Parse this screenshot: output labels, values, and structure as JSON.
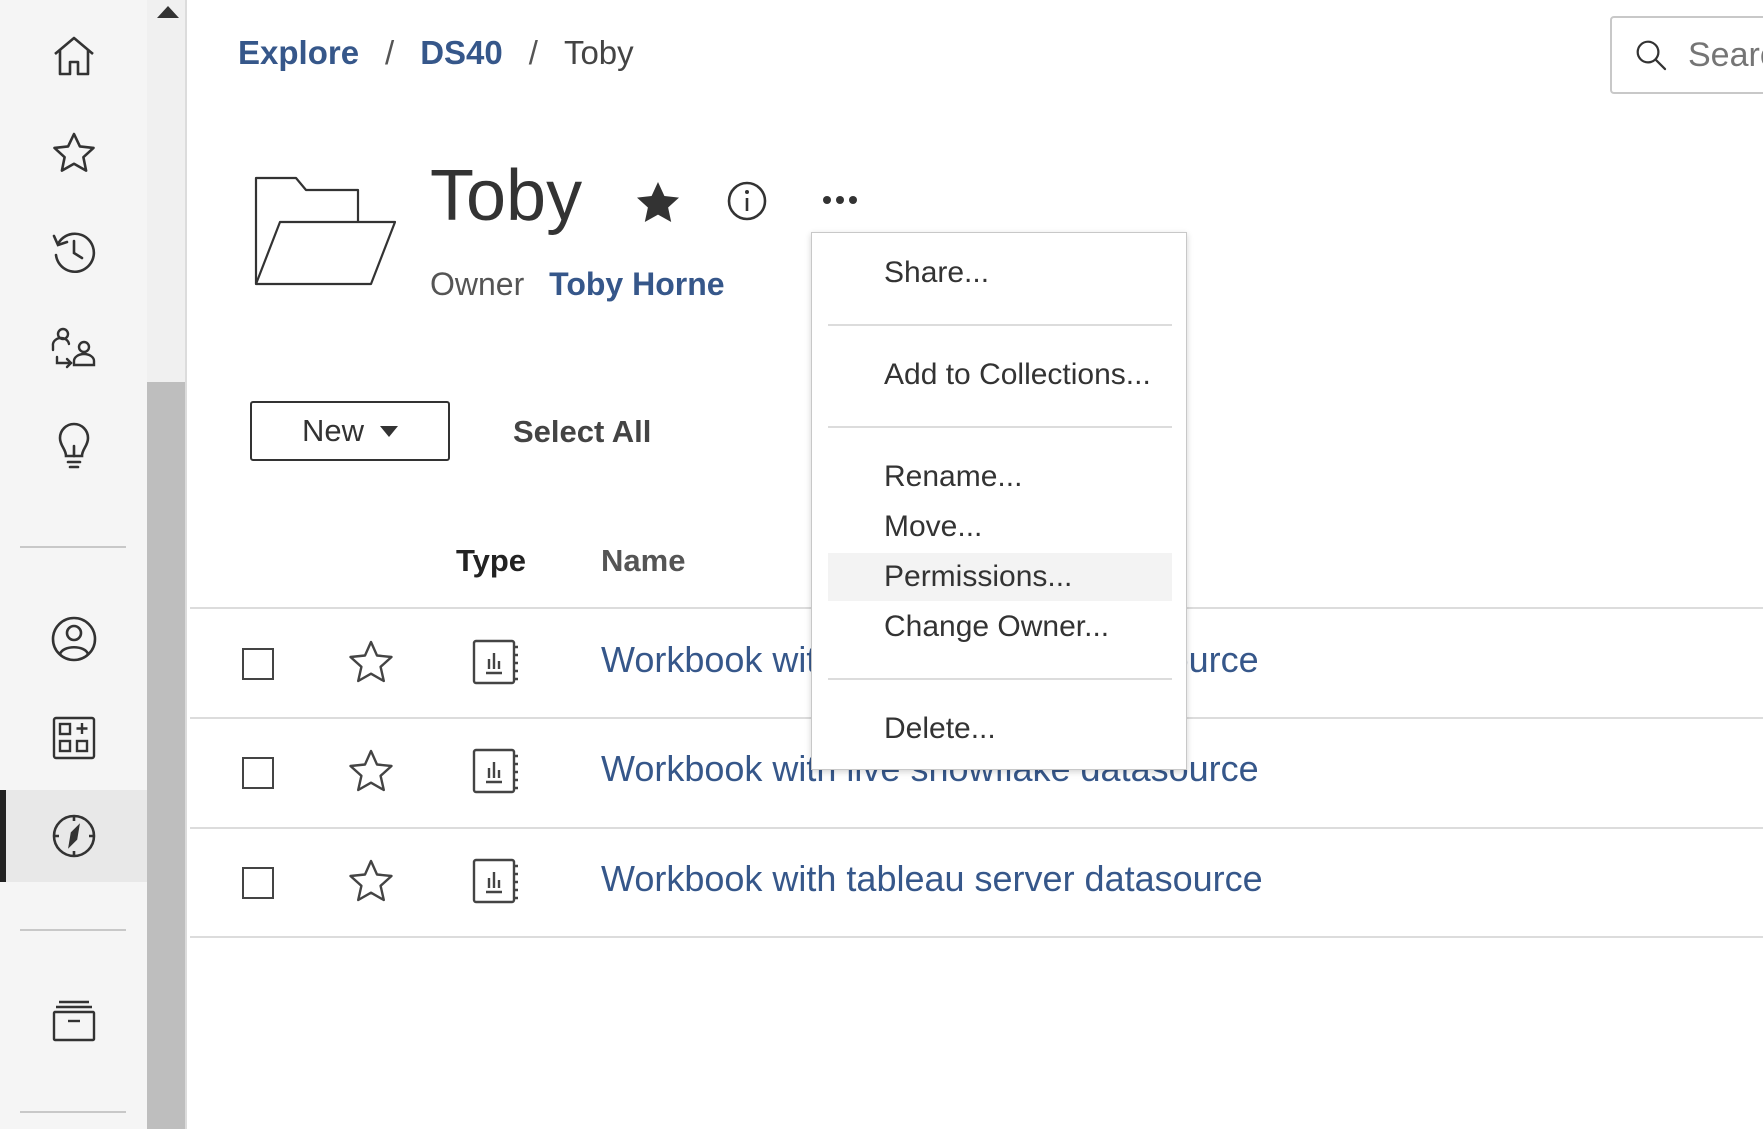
{
  "breadcrumb": {
    "items": [
      "Explore",
      "DS40"
    ],
    "separator": "/",
    "current": "Toby"
  },
  "search": {
    "placeholder": "Search"
  },
  "header": {
    "title": "Toby",
    "owner_label": "Owner",
    "owner_name": "Toby Horne"
  },
  "toolbar": {
    "new_label": "New",
    "select_all_label": "Select All"
  },
  "table": {
    "columns": [
      "Type",
      "Name"
    ],
    "rows": [
      {
        "name": "Workbook with live snowflake datasource",
        "type_icon": "workbook-icon"
      },
      {
        "name": "Workbook with live snowflake datasource",
        "type_icon": "workbook-icon"
      },
      {
        "name": "Workbook with tableau server datasource",
        "type_icon": "workbook-icon"
      }
    ]
  },
  "menu": {
    "items": [
      "Share...",
      "Add to Collections...",
      "Rename...",
      "Move...",
      "Permissions...",
      "Change Owner...",
      "Delete..."
    ],
    "highlighted": "Permissions..."
  },
  "nav": {
    "icons": [
      "home-icon",
      "favorites-star-icon",
      "recents-clock-icon",
      "shared-with-me-icon",
      "recommendations-lightbulb-icon",
      "personal-space-user-icon",
      "collections-icon",
      "explore-compass-icon",
      "external-assets-archive-icon"
    ],
    "active": "explore-compass-icon"
  },
  "colors": {
    "link": "#36578a",
    "text": "#333333",
    "nav_bg": "#f5f5f5",
    "scroll_thumb": "#bebebe"
  }
}
